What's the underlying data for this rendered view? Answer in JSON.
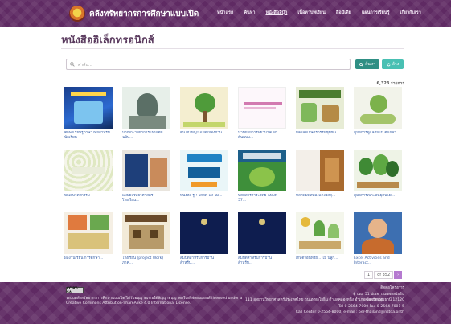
{
  "header": {
    "site_title": "คลังทรัพยากรการศึกษาแบบเปิด",
    "menu": [
      "หน้าแรก",
      "ค้นหา",
      "หนังสืออีบุ๊ก",
      "เนื้อหาบทเรียน",
      "สื่อมีเดีย",
      "แผนการเรียนรู้",
      "เกี่ยวกับเรา"
    ]
  },
  "page": {
    "title": "หนังสืออิเล็กทรอนิกส์"
  },
  "search": {
    "placeholder": "คำค้น...",
    "search_label": "ค้นหา",
    "reset_label": "ล้าง"
  },
  "result_count": "6,323 รายการ",
  "books": [
    {
      "caption": "ศึกษาเรียนรู้ภาษาไทยสำหรับนักเรียน",
      "icon": "book-cover-blue"
    },
    {
      "caption": "ปกิณกะวิทยาการ เพิ่มเติม ฉบับ...",
      "icon": "book-cover-portrait"
    },
    {
      "caption": "ต้นไม้ใหญ่ในเขตเมืองบ้าน",
      "icon": "book-cover-tree"
    },
    {
      "caption": "นวนิยายการพยาบาลเด็ก ต้นแบบ...",
      "icon": "book-cover-pale"
    },
    {
      "caption": "ผลผลิตเกษตรกรรมชุมชน",
      "icon": "book-cover-plants"
    },
    {
      "caption": "คู่มือการดูแลต้นไม้ ต้นกล้า...",
      "icon": "book-cover-seedling"
    },
    {
      "caption": "ปักเย็บจิตรกรรม",
      "icon": "book-cover-pattern"
    },
    {
      "caption": "แผนผังวิทยาศาสตร์ โรงเรียน...",
      "icon": "book-cover-classroom"
    },
    {
      "caption": "หนังสือ รู้ ! โควิด-19 ไม่...",
      "icon": "book-cover-covid"
    },
    {
      "caption": "นิตยสารสาระวิทย์ ฉบับที่ 57...",
      "icon": "book-cover-magazine"
    },
    {
      "caption": "หลักพิมพ์สีทองแดงวัสดุ...",
      "icon": "book-cover-wood"
    },
    {
      "caption": "คู่มือการเพาะพันธุ์ต้นไม้...",
      "icon": "book-cover-trees"
    },
    {
      "caption": "ผลงานเรียน การศึกษา...",
      "icon": "book-cover-collage"
    },
    {
      "caption": "โรงเรียน (project Work) ภาค...",
      "icon": "book-cover-building"
    },
    {
      "caption": "สมบัติสำหรับการบ้าน สำหรับ...",
      "icon": "book-cover-navy"
    },
    {
      "caption": "สมบัติสำหรับการบ้าน สำหรับ...",
      "icon": "book-cover-navy"
    },
    {
      "caption": "เกษตรอินทรีย์... ไม้ ปลูก...",
      "icon": "book-cover-garden"
    },
    {
      "caption": "Excel Activities and Interact...",
      "icon": "book-cover-person"
    }
  ],
  "pagination": {
    "current": "1",
    "total": "of 352",
    "next": "›"
  },
  "footer": {
    "cc_badge": "CC BY-SA",
    "license_line1": "ระบบคลังทรัพยากรการศึกษาแบบเปิด ได้รับอนุญาตภายใต้สัญญาอนุญาตครีเอทีฟคอมมอนส์ licensed under a",
    "license_line2": "Creative Commons Attribution-ShareAlike 4.0 International License.",
    "address_left": "111 อุทยานวิทยาศาสตร์ประเทศไทย ถนนพหลโยธิน ตำบลคลองหนึ่ง อำเภอคลองหลวง",
    "address_lines": [
      "ติดต่อโครงการ",
      "ตู้ ปณ. 51 ปณจ. ถนนพหลโยธิน",
      "จังหวัดปทุมธานี 12120",
      "Tel 0-2564-7000 Fax 0-2564-7001-5",
      "Call Center 0-2564-8000, e-mail : oer-thailand@nstda.or.th"
    ]
  },
  "colors": {
    "header": "#5f2a63",
    "title": "#5a3a5e",
    "search_btn": "#2f8f84",
    "reset_btn": "#49c0b3",
    "link": "#3a62a8"
  }
}
